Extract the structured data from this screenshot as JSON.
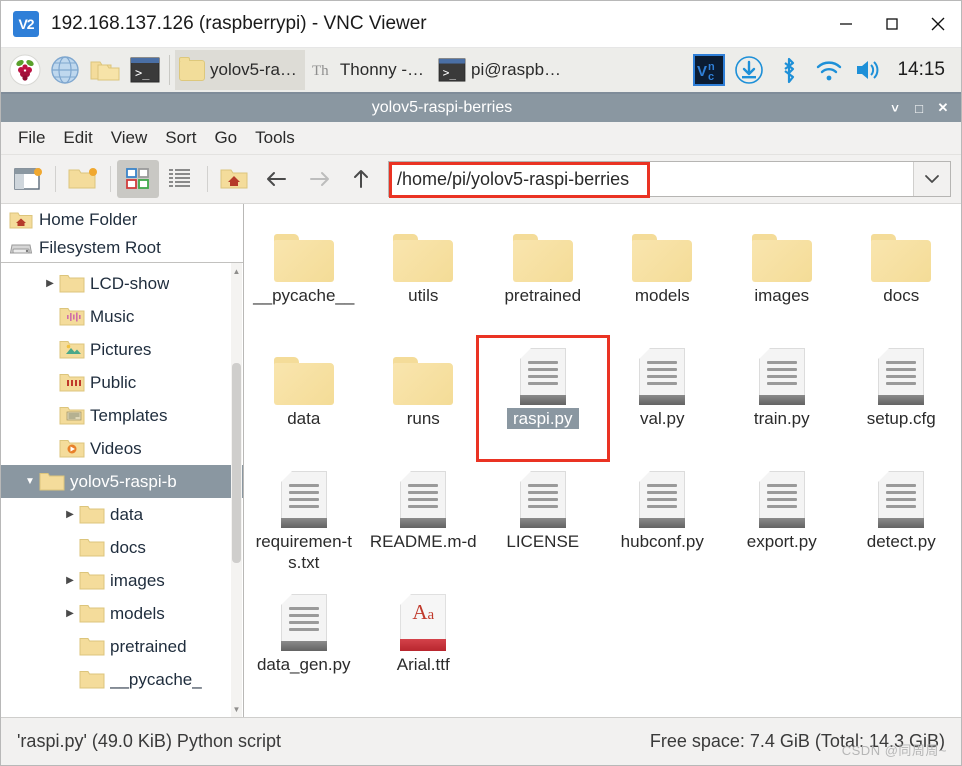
{
  "vnc_window": {
    "title": "192.168.137.126 (raspberrypi) - VNC Viewer",
    "logo_text": "V2",
    "controls": {
      "minimize": "minimize-icon",
      "maximize": "maximize-icon",
      "close": "close-icon"
    }
  },
  "taskbar": {
    "launchers": [
      {
        "name": "raspberry-menu-icon",
        "label": ""
      },
      {
        "name": "web-browser-icon",
        "label": ""
      },
      {
        "name": "file-manager-icon",
        "label": ""
      },
      {
        "name": "terminal-icon",
        "label": ""
      }
    ],
    "tasks": [
      {
        "name": "task-file-manager",
        "label": "yolov5-ra…",
        "icon": "folder-icon",
        "active": true
      },
      {
        "name": "task-thonny",
        "label": "Thonny  -…",
        "icon": "thonny-icon",
        "active": false
      },
      {
        "name": "task-terminal",
        "label": "pi@raspb…",
        "icon": "terminal-icon",
        "active": false
      }
    ],
    "tray": [
      {
        "name": "vnc-server-icon"
      },
      {
        "name": "updates-icon"
      },
      {
        "name": "bluetooth-icon"
      },
      {
        "name": "wifi-icon"
      },
      {
        "name": "volume-icon"
      }
    ],
    "clock": "14:15"
  },
  "file_manager": {
    "title": "yolov5-raspi-berries",
    "window_controls": {
      "minimize": "˅",
      "maximize": "□",
      "close": "✕"
    },
    "menu": [
      "File",
      "Edit",
      "View",
      "Sort",
      "Go",
      "Tools"
    ],
    "toolbar": {
      "buttons": [
        {
          "name": "new-tab-button"
        },
        {
          "name": "new-folder-button"
        },
        {
          "name": "icon-view-button",
          "active": true
        },
        {
          "name": "list-view-button",
          "active": false
        },
        {
          "name": "home-folder-button"
        },
        {
          "name": "back-button"
        },
        {
          "name": "forward-button"
        },
        {
          "name": "up-button"
        }
      ],
      "path_value": "/home/pi/yolov5-raspi-berries",
      "path_placeholder": "",
      "dropdown_icon": "chevron-down-icon"
    },
    "sidebar": {
      "places": [
        {
          "name": "home-folder",
          "label": "Home Folder",
          "icon": "home-folder-icon"
        },
        {
          "name": "filesystem-root",
          "label": "Filesystem Root",
          "icon": "drive-icon"
        }
      ],
      "tree": [
        {
          "label": "LCD-show",
          "icon": "folder-icon",
          "indent": 2,
          "arrow": "▶",
          "selected": false
        },
        {
          "label": "Music",
          "icon": "music-folder-icon",
          "indent": 2,
          "arrow": "",
          "selected": false
        },
        {
          "label": "Pictures",
          "icon": "pictures-folder-icon",
          "indent": 2,
          "arrow": "",
          "selected": false
        },
        {
          "label": "Public",
          "icon": "public-folder-icon",
          "indent": 2,
          "arrow": "",
          "selected": false
        },
        {
          "label": "Templates",
          "icon": "templates-folder-icon",
          "indent": 2,
          "arrow": "",
          "selected": false
        },
        {
          "label": "Videos",
          "icon": "videos-folder-icon",
          "indent": 2,
          "arrow": "",
          "selected": false
        },
        {
          "label": "yolov5-raspi-b",
          "icon": "folder-icon",
          "indent": 1,
          "arrow": "▼",
          "selected": true
        },
        {
          "label": "data",
          "icon": "folder-icon",
          "indent": 3,
          "arrow": "▶",
          "selected": false
        },
        {
          "label": "docs",
          "icon": "folder-icon",
          "indent": 3,
          "arrow": "",
          "selected": false
        },
        {
          "label": "images",
          "icon": "folder-icon",
          "indent": 3,
          "arrow": "▶",
          "selected": false
        },
        {
          "label": "models",
          "icon": "folder-icon",
          "indent": 3,
          "arrow": "▶",
          "selected": false
        },
        {
          "label": "pretrained",
          "icon": "folder-icon",
          "indent": 3,
          "arrow": "",
          "selected": false
        },
        {
          "label": "__pycache_",
          "icon": "folder-icon",
          "indent": 3,
          "arrow": "",
          "selected": false
        }
      ]
    },
    "files": [
      {
        "label": "__pycache__",
        "type": "folder",
        "selected": false
      },
      {
        "label": "utils",
        "type": "folder",
        "selected": false
      },
      {
        "label": "pretrained",
        "type": "folder",
        "selected": false
      },
      {
        "label": "models",
        "type": "folder",
        "selected": false
      },
      {
        "label": "images",
        "type": "folder",
        "selected": false
      },
      {
        "label": "docs",
        "type": "folder",
        "selected": false
      },
      {
        "label": "data",
        "type": "folder",
        "selected": false
      },
      {
        "label": "runs",
        "type": "folder",
        "selected": false
      },
      {
        "label": "raspi.py",
        "type": "file",
        "selected": true
      },
      {
        "label": "val.py",
        "type": "file",
        "selected": false
      },
      {
        "label": "train.py",
        "type": "file",
        "selected": false
      },
      {
        "label": "setup.cfg",
        "type": "file",
        "selected": false
      },
      {
        "label": "requiremen-ts.txt",
        "type": "file",
        "selected": false
      },
      {
        "label": "README.m-d",
        "type": "file",
        "selected": false
      },
      {
        "label": "LICENSE",
        "type": "file",
        "selected": false
      },
      {
        "label": "hubconf.py",
        "type": "file",
        "selected": false
      },
      {
        "label": "export.py",
        "type": "file",
        "selected": false
      },
      {
        "label": "detect.py",
        "type": "file",
        "selected": false
      },
      {
        "label": "data_gen.py",
        "type": "file",
        "selected": false
      },
      {
        "label": "Arial.ttf",
        "type": "ttf",
        "selected": false
      }
    ],
    "status": {
      "left": "'raspi.py' (49.0 KiB) Python script",
      "right": "Free space: 7.4 GiB (Total: 14.3 GiB)"
    }
  },
  "annotations": {
    "color": "#ea3323",
    "path_highlight": "/home/pi/yolov5-raspi-berries",
    "file_highlight": "raspi.py"
  },
  "watermark": "CSDN @同周周~"
}
